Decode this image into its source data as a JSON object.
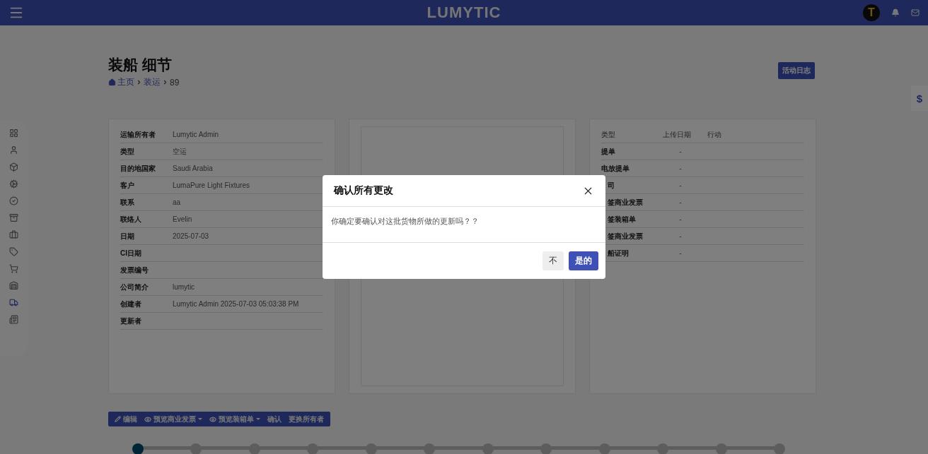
{
  "header": {
    "logo": "LUMYTIC",
    "avatar_letter": "T"
  },
  "sidebar": {
    "items": [
      {
        "selected": false
      },
      {
        "selected": false
      },
      {
        "selected": false
      },
      {
        "selected": false
      },
      {
        "selected": false
      },
      {
        "selected": false
      },
      {
        "selected": false
      },
      {
        "selected": false
      },
      {
        "selected": false
      },
      {
        "selected": false
      },
      {
        "selected": true
      },
      {
        "selected": false
      }
    ]
  },
  "page": {
    "title": "装船 细节",
    "breadcrumb": [
      "主页",
      "装运",
      "89"
    ],
    "activity_log_button": "活动日志",
    "side_tab": "$"
  },
  "details": [
    {
      "label": "运输所有者",
      "value": "Lumytic Admin"
    },
    {
      "label": "类型",
      "value": "空运"
    },
    {
      "label": "目的地国家",
      "value": "Saudi Arabia"
    },
    {
      "label": "客户",
      "value": "LumaPure Light Fixtures"
    },
    {
      "label": "联系",
      "value": "aa"
    },
    {
      "label": "联络人",
      "value": "Evelin"
    },
    {
      "label": "日期",
      "value": "2025-07-03"
    },
    {
      "label": "CI日期"
    },
    {
      "label": "发票编号"
    },
    {
      "label": "公司简介",
      "value": "lumytic"
    },
    {
      "label": "创建者",
      "value": "Lumytic Admin 2025-07-03 05:03:38 PM"
    },
    {
      "label": "更新者"
    }
  ],
  "documents": {
    "columns": [
      "类型",
      "上传日期",
      "行动"
    ],
    "rows": [
      {
        "label": "提单",
        "upload_date": "-",
        "clipped": false
      },
      {
        "label": "电放提单",
        "upload_date": "-",
        "clipped": false
      },
      {
        "label": "司",
        "upload_date": "-",
        "clipped": true
      },
      {
        "label": "签商业发票",
        "upload_date": "-",
        "clipped": true
      },
      {
        "label": "签装箱单",
        "upload_date": "-",
        "clipped": true
      },
      {
        "label": "签商业发票",
        "upload_date": "-",
        "clipped": true
      },
      {
        "label": "船证明",
        "upload_date": "-",
        "clipped": true
      }
    ]
  },
  "toolbar": [
    {
      "kind": "edit",
      "label": "编辑"
    },
    {
      "kind": "preview",
      "label": "预览商业发票"
    },
    {
      "kind": "preview",
      "label": "预览装箱单"
    },
    {
      "kind": "plain",
      "label": "确认"
    },
    {
      "kind": "plain",
      "label": "更换所有者"
    }
  ],
  "stepper": [
    {
      "active": true
    },
    {
      "active": false
    },
    {
      "active": false
    },
    {
      "active": false
    },
    {
      "active": false
    },
    {
      "active": false
    },
    {
      "active": false
    },
    {
      "active": false
    },
    {
      "active": false
    },
    {
      "active": false
    },
    {
      "active": false
    },
    {
      "active": false
    }
  ],
  "dialog": {
    "title": "确认所有更改",
    "message": "你确定要确认对这批货物所做的更新吗？？",
    "buttons": [
      {
        "kind": "secondary",
        "label": "不"
      },
      {
        "kind": "primary",
        "label": "是的"
      }
    ]
  }
}
